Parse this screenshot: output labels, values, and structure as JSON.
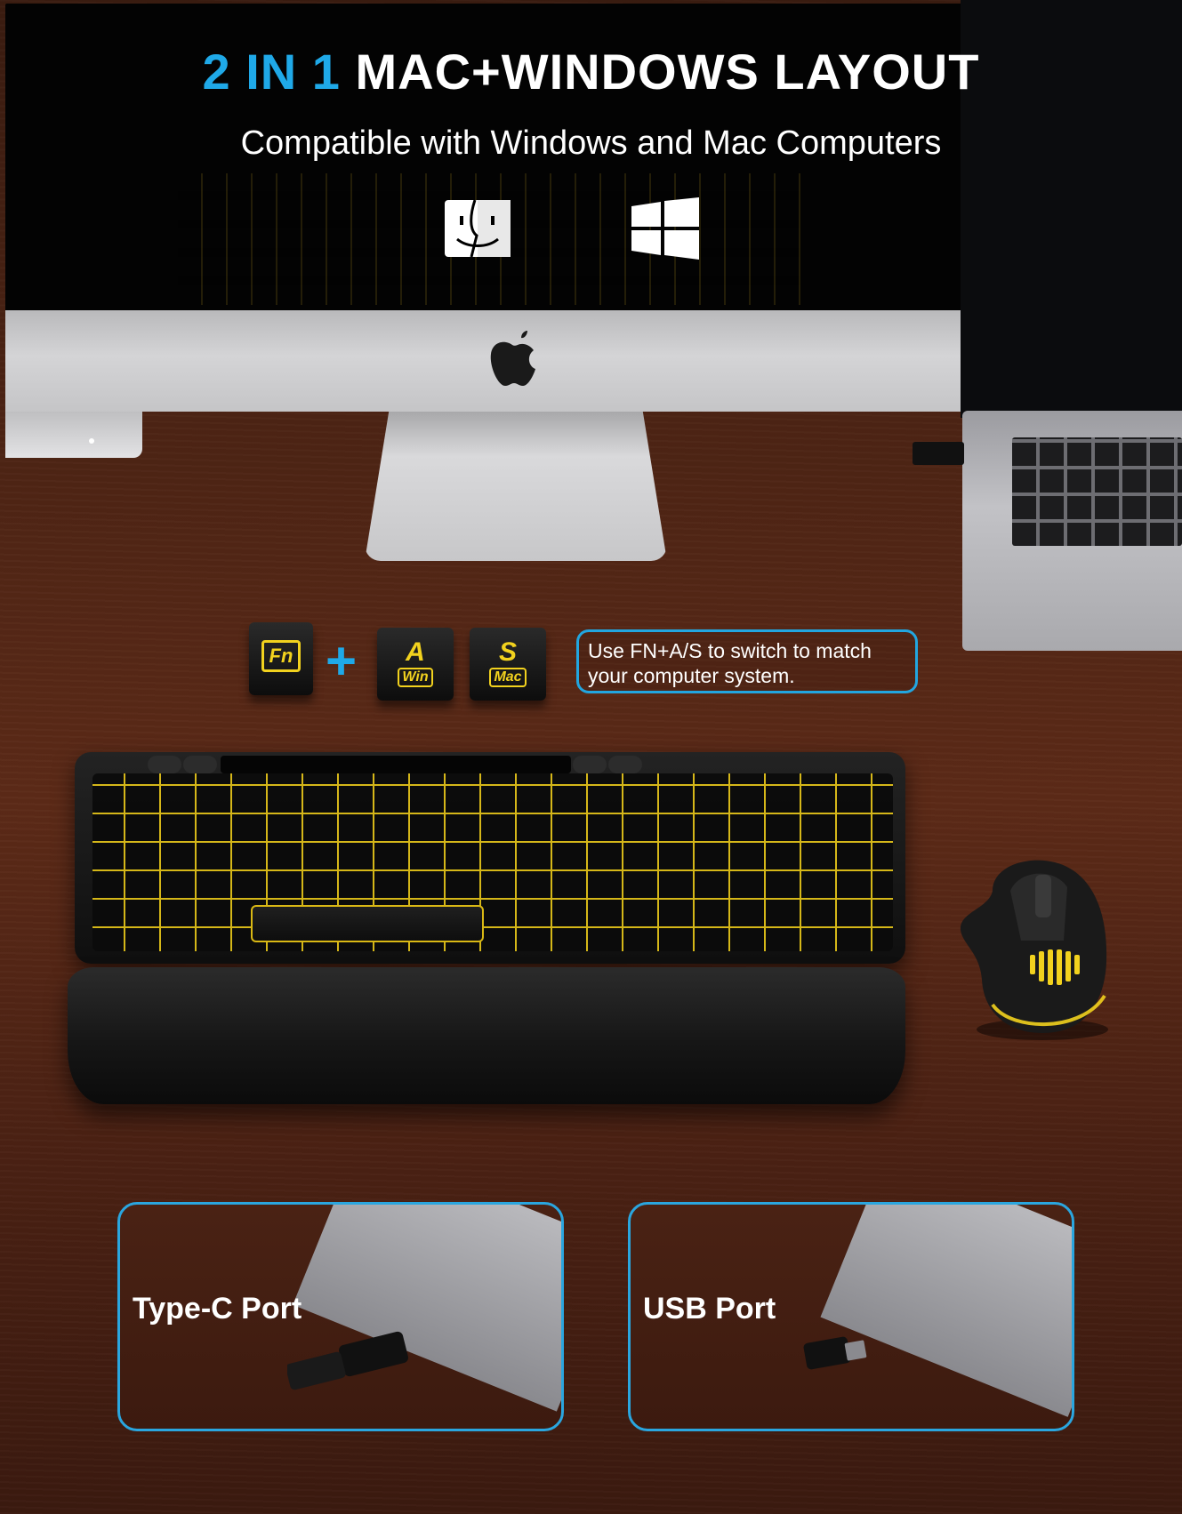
{
  "headline": {
    "accent": "2 IN 1",
    "rest": "MAC+WINDOWS LAYOUT"
  },
  "subheadline": "Compatible with Windows and Mac Computers",
  "os_icons": [
    "finder-icon",
    "windows-icon"
  ],
  "switch": {
    "fn_key": "Fn",
    "plus": "+",
    "a_key": {
      "letter": "A",
      "tag": "Win"
    },
    "s_key": {
      "letter": "S",
      "tag": "Mac"
    },
    "tip_line1": "Use FN+A/S to switch to match",
    "tip_line2": "your computer system."
  },
  "ports": [
    {
      "label": "Type-C Port"
    },
    {
      "label": "USB Port"
    }
  ],
  "colors": {
    "accent_blue": "#1fa9e8",
    "backlight_yellow": "#f2d21e",
    "desk_wood": "#4d2414"
  }
}
